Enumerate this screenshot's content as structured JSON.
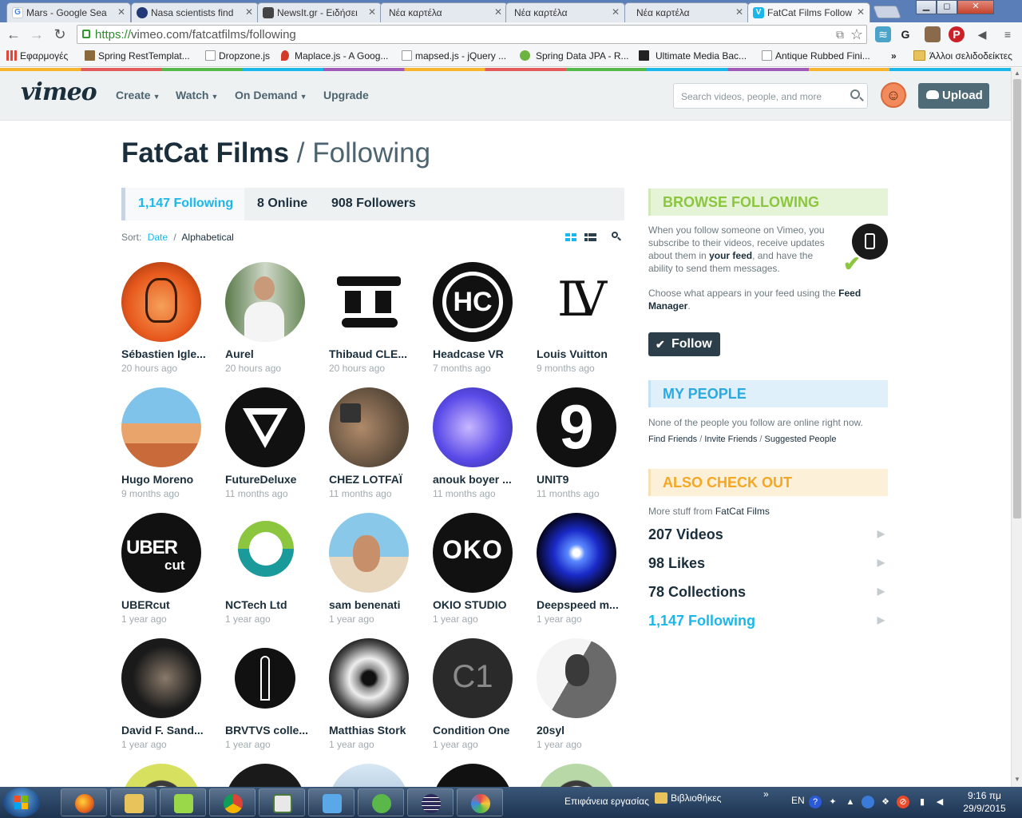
{
  "browser": {
    "tabs": [
      {
        "label": "Mars - Google Sea",
        "favicon_color": "#4285f4",
        "favicon_letter": "G"
      },
      {
        "label": "Nasa scientists find",
        "favicon_color": "#223a78",
        "favicon_letter": ""
      },
      {
        "label": "NewsIt.gr - Ειδήσει",
        "favicon_color": "#444444",
        "favicon_letter": ""
      },
      {
        "label": "Νέα καρτέλα",
        "favicon_color": "",
        "favicon_letter": ""
      },
      {
        "label": "Νέα καρτέλα",
        "favicon_color": "",
        "favicon_letter": ""
      },
      {
        "label": "Νέα καρτέλα",
        "favicon_color": "",
        "favicon_letter": ""
      },
      {
        "label": "FatCat Films Follow",
        "favicon_color": "#1ab7ea",
        "favicon_letter": "V"
      }
    ],
    "url_scheme": "https://",
    "url_rest": "vimeo.com/fatcatfilms/following",
    "bookmarks": [
      {
        "label": "Εφαρμογές",
        "icon_color": "#e0463a"
      },
      {
        "label": "Spring RestTemplat...",
        "icon_color": "#8a6a3a"
      },
      {
        "label": "Dropzone.js",
        "icon_color": "#ffffff"
      },
      {
        "label": "Maplace.js - A Goog...",
        "icon_color": "#d23a2a"
      },
      {
        "label": "mapsed.js - jQuery ...",
        "icon_color": "#ffffff"
      },
      {
        "label": "Spring Data JPA - R...",
        "icon_color": "#6db33f"
      },
      {
        "label": "Ultimate Media Bac...",
        "icon_color": "#222222"
      },
      {
        "label": "Antique Rubbed Fini...",
        "icon_color": "#ffffff"
      }
    ],
    "bookmarks_overflow": "»",
    "other_bookmarks": "Άλλοι σελιδοδείκτες"
  },
  "vimeo": {
    "logo": "vimeo",
    "nav": [
      {
        "label": "Create",
        "has_caret": true
      },
      {
        "label": "Watch",
        "has_caret": true
      },
      {
        "label": "On Demand",
        "has_caret": true
      },
      {
        "label": "Upgrade",
        "has_caret": false
      }
    ],
    "search_placeholder": "Search videos, people, and more",
    "upload_label": "Upload"
  },
  "page": {
    "owner": "FatCat Films",
    "separator": "/",
    "section": "Following",
    "stats": [
      {
        "label": "1,147 Following",
        "active": true
      },
      {
        "label": "8 Online",
        "active": false
      },
      {
        "label": "908 Followers",
        "active": false
      }
    ],
    "sort_label": "Sort:",
    "sort_date": "Date",
    "sort_sep": "/",
    "sort_alpha": "Alphabetical",
    "people": [
      {
        "name": "Sébastien Igle...",
        "time": "20 hours ago",
        "pic": "orange-illustration"
      },
      {
        "name": "Aurel",
        "time": "20 hours ago",
        "pic": "photo-man-white-shirt"
      },
      {
        "name": "Thibaud CLE...",
        "time": "20 hours ago",
        "pic": "black-glyph"
      },
      {
        "name": "Headcase VR",
        "time": "7 months ago",
        "pic": "hc-logo"
      },
      {
        "name": "Louis Vuitton",
        "time": "9 months ago",
        "pic": "lv-logo"
      },
      {
        "name": "Hugo Moreno",
        "time": "9 months ago",
        "pic": "desert-illustration"
      },
      {
        "name": "FutureDeluxe",
        "time": "11 months ago",
        "pic": "triangle-logo"
      },
      {
        "name": "CHEZ LOTFAÏ",
        "time": "11 months ago",
        "pic": "photo-man-camera"
      },
      {
        "name": "anouk boyer ...",
        "time": "11 months ago",
        "pic": "photo-blue-face"
      },
      {
        "name": "UNIT9",
        "time": "11 months ago",
        "pic": "unit9-logo"
      },
      {
        "name": "UBERcut",
        "time": "1 year ago",
        "pic": "ubercut-logo"
      },
      {
        "name": "NCTech Ltd",
        "time": "1 year ago",
        "pic": "nctech-logo"
      },
      {
        "name": "sam benenati",
        "time": "1 year ago",
        "pic": "photo-snorkel"
      },
      {
        "name": "OKIO STUDIO",
        "time": "1 year ago",
        "pic": "okio-logo"
      },
      {
        "name": "Deepspeed m...",
        "time": "1 year ago",
        "pic": "blue-glow"
      },
      {
        "name": "David F. Sand...",
        "time": "1 year ago",
        "pic": "photo-bearded"
      },
      {
        "name": "BRVTVS colle...",
        "time": "1 year ago",
        "pic": "brvtvs-logo"
      },
      {
        "name": "Matthias Stork",
        "time": "1 year ago",
        "pic": "eye-photo"
      },
      {
        "name": "Condition One",
        "time": "1 year ago",
        "pic": "c1-logo"
      },
      {
        "name": "20syl",
        "time": "1 year ago",
        "pic": "photo-bw-man"
      }
    ]
  },
  "sidebar": {
    "browse_title": "BROWSE FOLLOWING",
    "browse_text_1a": "When you follow someone on Vimeo, you subscribe to their videos, receive updates about them in ",
    "browse_text_1b": "your feed",
    "browse_text_1c": ", and have the ability to send them messages.",
    "browse_text_2a": "Choose what appears in your feed using the ",
    "browse_text_2b": "Feed Manager",
    "browse_text_2c": ".",
    "follow_label": "Follow",
    "people_title": "MY PEOPLE",
    "people_text": "None of the people you follow are online right now.",
    "people_links": [
      "Find Friends",
      "Invite Friends",
      "Suggested People"
    ],
    "also_title": "ALSO CHECK OUT",
    "also_intro_a": "More stuff from ",
    "also_intro_b": "FatCat Films",
    "also_items": [
      {
        "label": "207 Videos",
        "active": false
      },
      {
        "label": "98 Likes",
        "active": false
      },
      {
        "label": "78 Collections",
        "active": false
      },
      {
        "label": "1,147 Following",
        "active": true
      }
    ]
  },
  "taskbar": {
    "desktop_label": "Επιφάνεια εργασίας",
    "libraries_label": "Βιβλιοθήκες",
    "lang": "EN",
    "time": "9:16 πμ",
    "date": "29/9/2015"
  },
  "colors": {
    "accent": "#1ab7ea",
    "browse_green": "#8cc63f",
    "people_blue": "#2ba9e1",
    "also_orange": "#f5a623"
  }
}
